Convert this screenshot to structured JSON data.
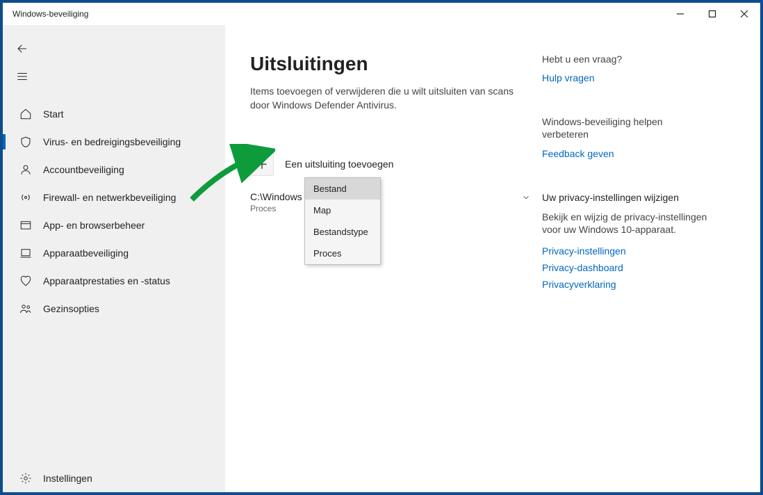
{
  "window_title": "Windows-beveiliging",
  "sidebar": {
    "items": [
      {
        "label": "Start"
      },
      {
        "label": "Virus- en bedreigingsbeveiliging"
      },
      {
        "label": "Accountbeveiliging"
      },
      {
        "label": "Firewall- en netwerkbeveiliging"
      },
      {
        "label": "App- en browserbeheer"
      },
      {
        "label": "Apparaatbeveiliging"
      },
      {
        "label": "Apparaatprestaties en -status"
      },
      {
        "label": "Gezinsopties"
      }
    ],
    "settings_label": "Instellingen"
  },
  "main": {
    "title": "Uitsluitingen",
    "subtitle": "Items toevoegen of verwijderen die u wilt uitsluiten van scans door Windows Defender Antivirus.",
    "add_label": "Een uitsluiting toevoegen",
    "exclusion": {
      "path_display": "C:\\Windows                       nost.exe",
      "type": "Proces"
    },
    "dropdown": {
      "items": [
        "Bestand",
        "Map",
        "Bestandstype",
        "Proces"
      ]
    }
  },
  "side": {
    "help": {
      "head": "Hebt u een vraag?",
      "link": "Hulp vragen"
    },
    "improve": {
      "head": "Windows-beveiliging helpen verbeteren",
      "link": "Feedback geven"
    },
    "privacy": {
      "head": "Uw privacy-instellingen wijzigen",
      "desc": "Bekijk en wijzig de privacy-instellingen voor uw Windows 10-apparaat.",
      "links": [
        "Privacy-instellingen",
        "Privacy-dashboard",
        "Privacyverklaring"
      ]
    }
  }
}
